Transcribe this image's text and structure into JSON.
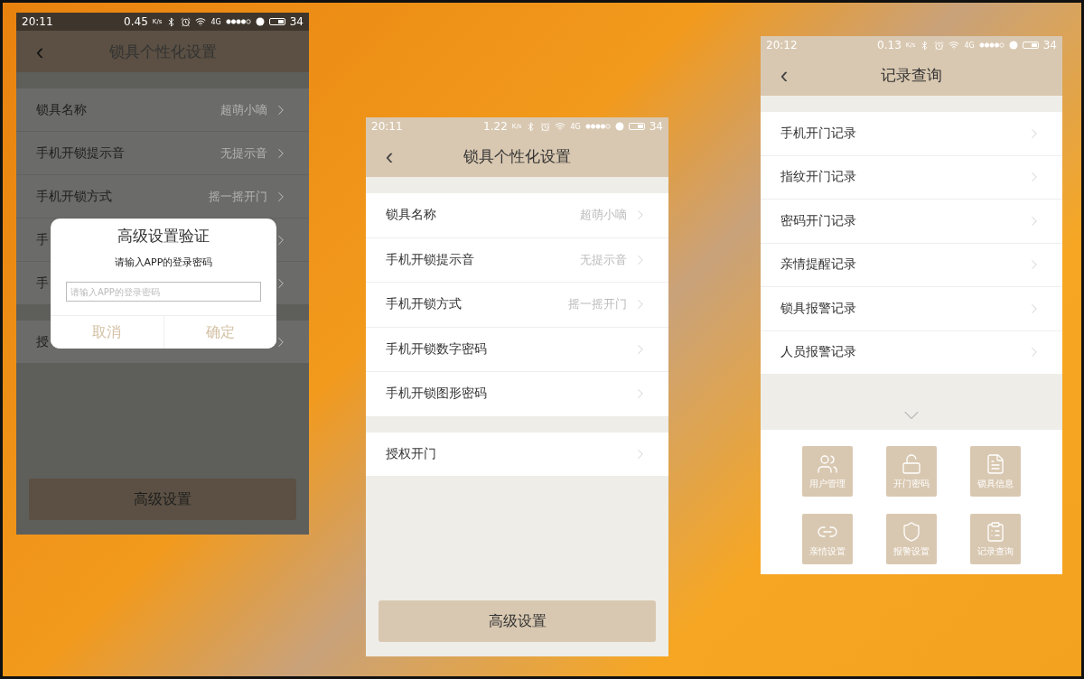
{
  "screens": [
    {
      "kind": "settings",
      "dimmed": true,
      "status": {
        "time": "20:11",
        "speed": "0.45",
        "speed_unit": "K/s",
        "network": "4G",
        "battery": "34"
      },
      "title": "锁具个性化设置",
      "back": "‹",
      "groups": [
        [
          {
            "label": "锁具名称",
            "value": "超萌小嘀"
          },
          {
            "label": "手机开锁提示音",
            "value": "无提示音"
          },
          {
            "label": "手机开锁方式",
            "value": "摇一摇开门"
          },
          {
            "label": "手"
          },
          {
            "label": "手"
          }
        ],
        [
          {
            "label": "授"
          }
        ]
      ],
      "button": "高级设置",
      "dialog": {
        "title": "高级设置验证",
        "message": "请输入APP的登录密码",
        "placeholder": "请输入APP的登录密码",
        "buttons": [
          "取消",
          "确定"
        ]
      }
    },
    {
      "kind": "settings",
      "dimmed": false,
      "status": {
        "time": "20:11",
        "speed": "1.22",
        "speed_unit": "K/s",
        "network": "4G",
        "battery": "34"
      },
      "title": "锁具个性化设置",
      "back": "‹",
      "groups": [
        [
          {
            "label": "锁具名称",
            "value": "超萌小嘀"
          },
          {
            "label": "手机开锁提示音",
            "value": "无提示音"
          },
          {
            "label": "手机开锁方式",
            "value": "摇一摇开门"
          },
          {
            "label": "手机开锁数字密码"
          },
          {
            "label": "手机开锁图形密码"
          }
        ],
        [
          {
            "label": "授权开门"
          }
        ]
      ],
      "button": "高级设置"
    },
    {
      "kind": "records",
      "dimmed": false,
      "status": {
        "time": "20:12",
        "speed": "0.13",
        "speed_unit": "K/s",
        "network": "4G",
        "battery": "34"
      },
      "title": "记录查询",
      "back": "‹",
      "groups": [
        [
          {
            "label": "手机开门记录"
          },
          {
            "label": "指纹开门记录"
          },
          {
            "label": "密码开门记录"
          },
          {
            "label": "亲情提醒记录"
          },
          {
            "label": "锁具报警记录"
          },
          {
            "label": "人员报警记录"
          }
        ]
      ],
      "tiles": [
        {
          "kind": "users",
          "label": "用户管理"
        },
        {
          "kind": "unlock",
          "label": "开门密码"
        },
        {
          "kind": "file",
          "label": "锁具信息"
        },
        {
          "kind": "link",
          "label": "亲情设置"
        },
        {
          "kind": "shield",
          "label": "报警设置"
        },
        {
          "kind": "clipboard",
          "label": "记录查询"
        }
      ]
    }
  ]
}
